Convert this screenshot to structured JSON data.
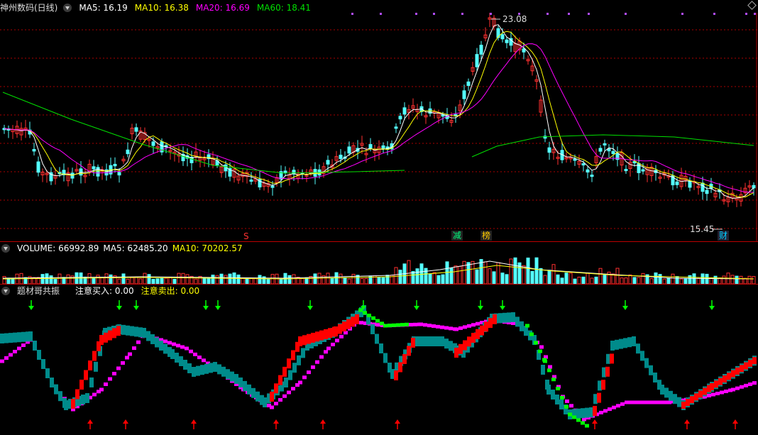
{
  "price_panel": {
    "title": "神州数码(日线)",
    "ma5": "MA5: 16.19",
    "ma10": "MA10: 16.38",
    "ma20": "MA20: 16.69",
    "ma60": "MA60: 18.41",
    "high_label": "23.08",
    "low_label": "15.45",
    "markers": {
      "s": "S",
      "reduce": "减",
      "list": "榜",
      "finance": "财"
    }
  },
  "volume_panel": {
    "volume": "VOLUME: 66992.89",
    "ma5": "MA5: 62485.20",
    "ma10": "MA10: 70202.57"
  },
  "indicator_panel": {
    "title": "题材哥共振",
    "buy": "注意买入: 0.00",
    "sell": "注意卖出: 0.00"
  },
  "colors": {
    "up": "#ff3030",
    "down": "#54ffff",
    "ma5": "#ffffff",
    "ma10": "#ffff00",
    "ma20": "#ff00ff",
    "ma60": "#00e000",
    "grid": "#aa0000",
    "teal": "#008b8b",
    "green": "#00ff00",
    "magenta": "#ff00ff",
    "red": "#ff0000"
  }
}
